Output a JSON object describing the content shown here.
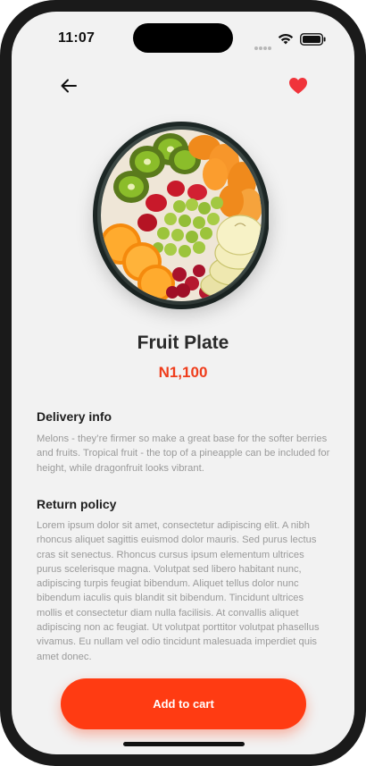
{
  "status_bar": {
    "time": "11:07"
  },
  "header": {
    "back_icon": "arrow-left-icon",
    "favorite_icon": "heart-icon",
    "favorite_color": "#f0343b"
  },
  "product": {
    "image_alt": "Fruit Plate",
    "name": "Fruit Plate",
    "price": "N1,100",
    "price_color": "#ef3d1c"
  },
  "delivery": {
    "heading": "Delivery info",
    "text": "Melons - they’re firmer so make a great base for the softer berries and fruits. Tropical fruit - the top of a pineapple can be included for height, while dragonfruit looks vibrant."
  },
  "return_policy": {
    "heading": "Return policy",
    "text": "Lorem ipsum dolor sit amet, consectetur adipiscing elit. A nibh rhoncus aliquet sagittis euismod dolor mauris. Sed purus lectus cras sit senectus. Rhoncus cursus ipsum elementum ultrices purus scelerisque magna. Volutpat sed libero habitant nunc, adipiscing turpis feugiat bibendum. Aliquet tellus dolor nunc bibendum iaculis quis blandit sit bibendum. Tincidunt ultrices mollis et consectetur diam nulla facilisis. At convallis aliquet adipiscing non ac feugiat. Ut volutpat porttitor volutpat phasellus vivamus. Eu nullam vel odio tincidunt malesuada imperdiet quis amet donec."
  },
  "actions": {
    "add_to_cart": "Add to cart",
    "accent_color": "#ff3b12"
  }
}
